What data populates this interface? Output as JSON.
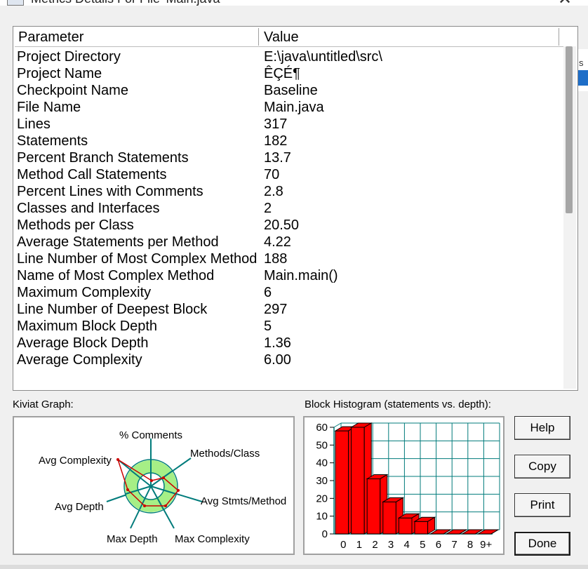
{
  "window": {
    "title": "Metrics Details For File 'Main.java'"
  },
  "table": {
    "columns": [
      "Parameter",
      "Value"
    ],
    "rows": [
      {
        "parameter": "Project Directory",
        "value": "E:\\java\\untitled\\src\\"
      },
      {
        "parameter": "Project Name",
        "value": "ÊÇÉ¶"
      },
      {
        "parameter": "Checkpoint Name",
        "value": "Baseline"
      },
      {
        "parameter": "File Name",
        "value": "Main.java"
      },
      {
        "parameter": "Lines",
        "value": "317"
      },
      {
        "parameter": "Statements",
        "value": "182"
      },
      {
        "parameter": "Percent Branch Statements",
        "value": "13.7"
      },
      {
        "parameter": "Method Call Statements",
        "value": "70"
      },
      {
        "parameter": "Percent Lines with Comments",
        "value": "2.8"
      },
      {
        "parameter": "Classes and Interfaces",
        "value": "2"
      },
      {
        "parameter": "Methods per Class",
        "value": "20.50"
      },
      {
        "parameter": "Average Statements per Method",
        "value": "4.22"
      },
      {
        "parameter": "Line Number of Most Complex Method",
        "value": "188"
      },
      {
        "parameter": "Name of Most Complex Method",
        "value": "Main.main()"
      },
      {
        "parameter": "Maximum Complexity",
        "value": "6"
      },
      {
        "parameter": "Line Number of Deepest Block",
        "value": "297"
      },
      {
        "parameter": "Maximum Block Depth",
        "value": "5"
      },
      {
        "parameter": "Average Block Depth",
        "value": "1.36"
      },
      {
        "parameter": "Average Complexity",
        "value": "6.00"
      }
    ]
  },
  "kiviat": {
    "label": "Kiviat Graph:",
    "axes": [
      "% Comments",
      "Methods/Class",
      "Avg Stmts/Method",
      "Max Complexity",
      "Max Depth",
      "Avg Depth",
      "Avg Complexity"
    ],
    "ring_color": "#a6ef86",
    "line_color": "#cc0000"
  },
  "histogram": {
    "label": "Block Histogram (statements vs. depth):",
    "bar_color": "#ff0000",
    "grid_color": "#007b7b"
  },
  "chart_data": {
    "type": "bar",
    "categories": [
      "0",
      "1",
      "2",
      "3",
      "4",
      "5",
      "6",
      "7",
      "8",
      "9+"
    ],
    "values": [
      58,
      60,
      31,
      18,
      9,
      7,
      0,
      0,
      0,
      0
    ],
    "ylim": [
      0,
      60
    ],
    "yticks": [
      0,
      10,
      20,
      30,
      40,
      50,
      60
    ],
    "grid": true
  },
  "buttons": {
    "help": "Help",
    "copy": "Copy",
    "print": "Print",
    "done": "Done"
  },
  "side_strip": {
    "text": "s"
  }
}
